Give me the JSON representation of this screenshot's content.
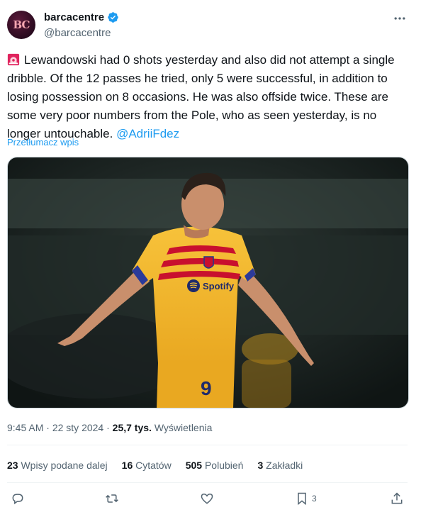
{
  "author": {
    "avatar_text": "BC",
    "name": "barcacentre",
    "handle": "@barcacentre"
  },
  "tweet": {
    "text": "Lewandowski had 0 shots yesterday and also did not attempt a single dribble. Of the 12 passes he tried, only 5 were successful, in addition to losing possession on 8 occasions. He was also offside twice. These are some very poor numbers from the Pole, who as seen yesterday, is no longer untouchable.",
    "mention": "@AdriiFdez",
    "translate_label": "Przetłumacz wpis"
  },
  "media": {
    "shirt_text": "Spotify",
    "shirt_number": "9"
  },
  "meta": {
    "time": "9:45 AM",
    "date": "22 sty 2024",
    "views_count": "25,7 tys.",
    "views_label": "Wyświetlenia"
  },
  "stats": {
    "reposts_count": "23",
    "reposts_label": "Wpisy podane dalej",
    "quotes_count": "16",
    "quotes_label": "Cytatów",
    "likes_count": "505",
    "likes_label": "Polubień",
    "bookmarks_count": "3",
    "bookmarks_label": "Zakładki"
  },
  "actions": {
    "bookmark_count": "3"
  },
  "colors": {
    "accent": "#1d9bf0",
    "muted": "#536471",
    "text": "#0f1419",
    "kit_yellow": "#f5b82e",
    "kit_red": "#c8102e"
  },
  "icons": [
    "verified-badge-icon",
    "more-icon",
    "siren-icon",
    "reply-icon",
    "repost-icon",
    "like-icon",
    "bookmark-icon",
    "share-icon"
  ]
}
